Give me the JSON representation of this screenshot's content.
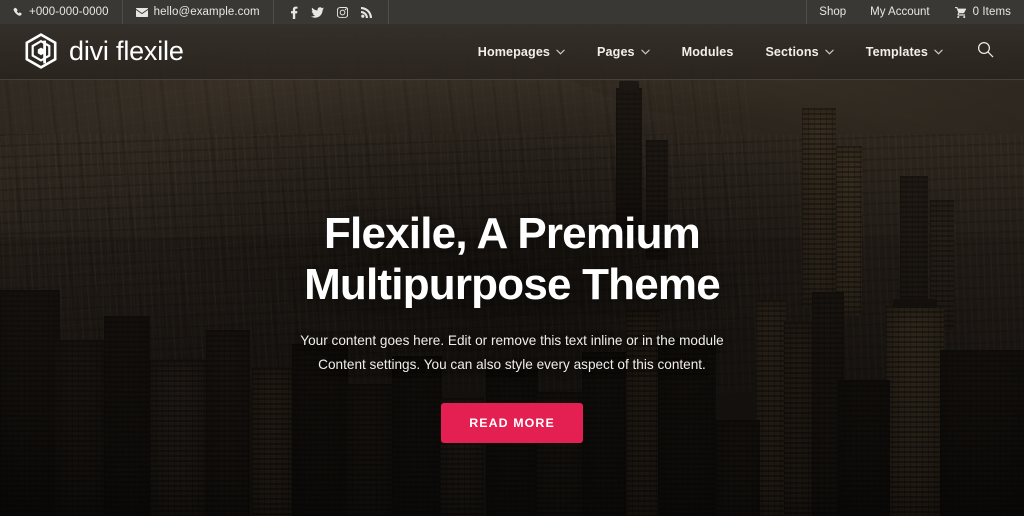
{
  "topbar": {
    "phone": {
      "icon": "phone-icon",
      "text": "+000-000-0000"
    },
    "email": {
      "icon": "envelope-icon",
      "text": "hello@example.com"
    },
    "socials": [
      {
        "icon": "facebook-icon",
        "label": "Facebook"
      },
      {
        "icon": "twitter-icon",
        "label": "Twitter"
      },
      {
        "icon": "instagram-icon",
        "label": "Instagram"
      },
      {
        "icon": "rss-icon",
        "label": "RSS"
      }
    ],
    "shop_label": "Shop",
    "account_label": "My Account",
    "cart": {
      "icon": "cart-icon",
      "text": "0 Items"
    },
    "background_color": "#3a3835"
  },
  "header": {
    "brand": {
      "logo_icon": "hexagon-d-logo",
      "name": "divi flexile"
    },
    "nav": [
      {
        "label": "Homepages",
        "has_dropdown": true
      },
      {
        "label": "Pages",
        "has_dropdown": true
      },
      {
        "label": "Modules",
        "has_dropdown": false
      },
      {
        "label": "Sections",
        "has_dropdown": true
      },
      {
        "label": "Templates",
        "has_dropdown": true
      }
    ],
    "search_icon": "search-icon"
  },
  "hero": {
    "title_line1": "Flexile, A Premium",
    "title_line2": "Multipurpose Theme",
    "subtitle": "Your content goes here. Edit or remove this text inline or in the module Content settings. You can also style every aspect of this content.",
    "cta_label": "READ MORE",
    "cta_color": "#e41f51",
    "background_image": "aerial-cityscape-photo"
  }
}
